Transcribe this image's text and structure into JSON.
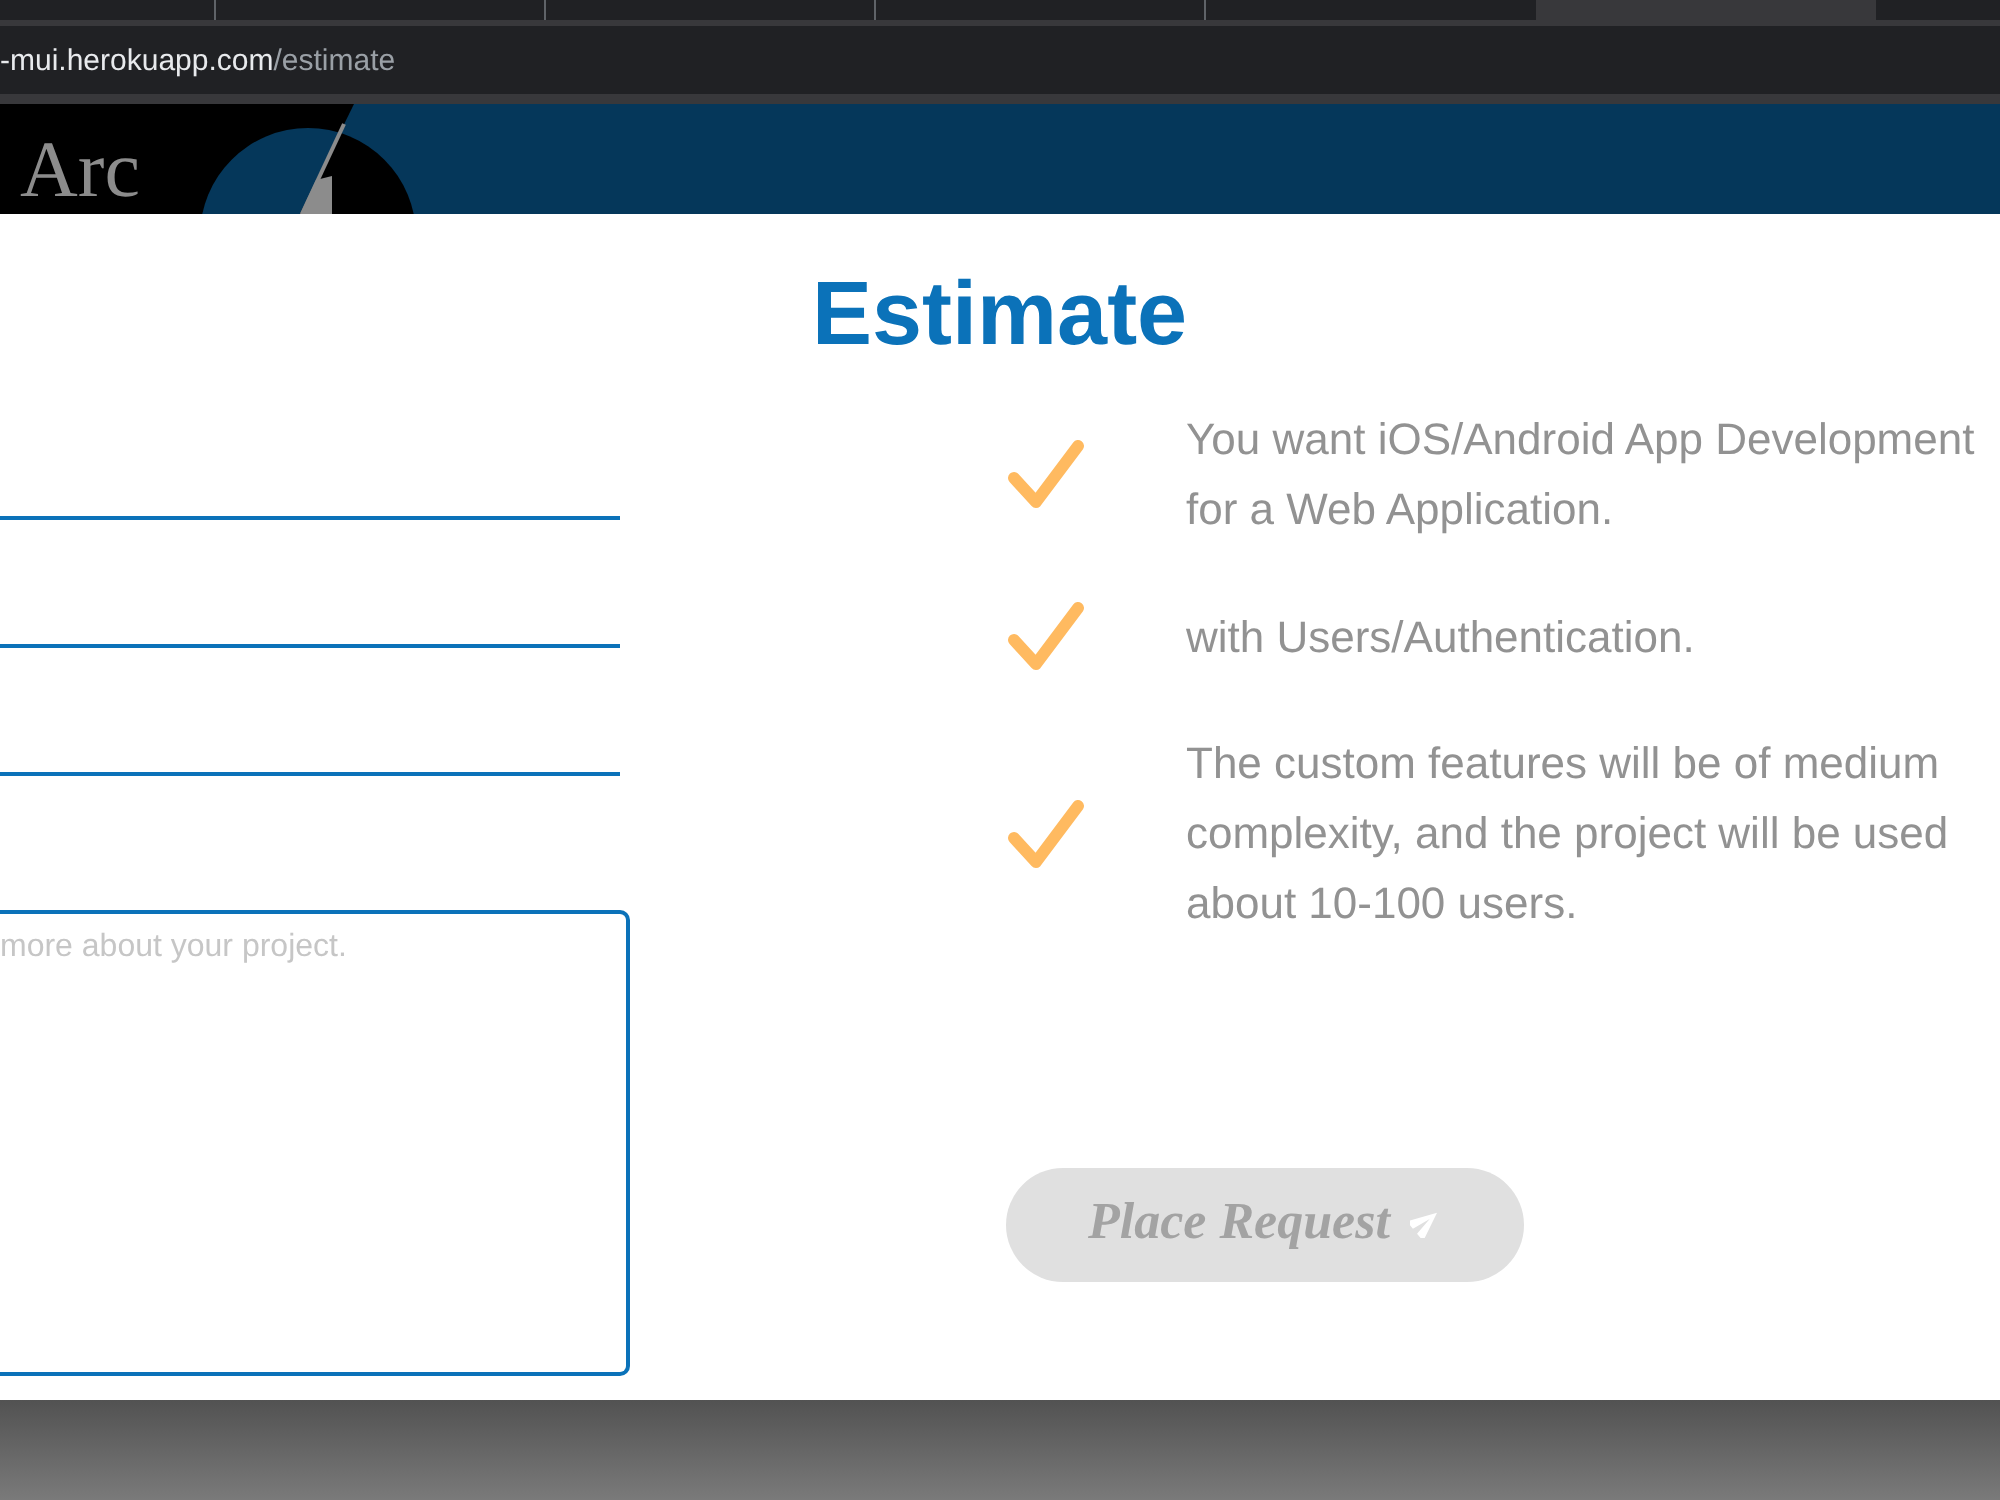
{
  "browser": {
    "tabs": [
      {
        "selected": false
      },
      {
        "selected": false
      },
      {
        "selected": false
      },
      {
        "selected": false
      },
      {
        "selected": false
      },
      {
        "selected": true
      },
      {
        "selected": false
      }
    ],
    "address_bar": {
      "host": "-mui.herokuapp.com",
      "path": "/estimate"
    }
  },
  "header": {
    "logo_text": "Arc"
  },
  "dialog": {
    "title": "Estimate",
    "fields": [
      {
        "kind": "underline"
      },
      {
        "kind": "underline"
      },
      {
        "kind": "underline"
      },
      {
        "kind": "textarea",
        "placeholder": "more about your project."
      }
    ],
    "summary": [
      {
        "lines": [
          "You want iOS/Android App Development",
          "for a Web Application."
        ]
      },
      {
        "lines": [
          "with Users/Authentication."
        ]
      },
      {
        "lines": [
          "The custom features will be of medium",
          "complexity, and the project will be used",
          "about 10-100 users."
        ]
      }
    ],
    "submit": {
      "label": "Place Request",
      "disabled": true
    }
  }
}
